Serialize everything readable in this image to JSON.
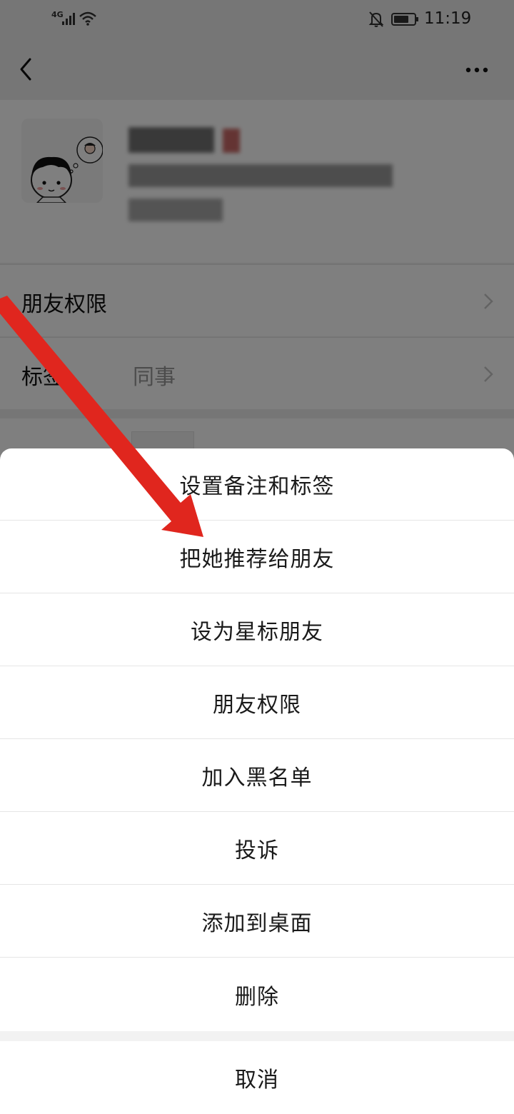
{
  "status_bar": {
    "network": "4G",
    "time": "11:19",
    "icons": [
      "signal-icon",
      "wifi-icon",
      "mute-bell-icon",
      "battery-icon"
    ]
  },
  "header": {
    "back_icon": "chevron-left-icon",
    "more_icon": "more-dots-icon"
  },
  "profile": {
    "avatar_icon": "cartoon-avatar-icon"
  },
  "rows": [
    {
      "label": "朋友权限",
      "value": ""
    },
    {
      "label": "标签",
      "value": "同事"
    }
  ],
  "action_sheet": {
    "items": [
      "设置备注和标签",
      "把她推荐给朋友",
      "设为星标朋友",
      "朋友权限",
      "加入黑名单",
      "投诉",
      "添加到桌面",
      "删除"
    ],
    "cancel_label": "取消"
  },
  "annotation": {
    "arrow_icon": "red-arrow-icon",
    "arrow_color": "#e0261e"
  },
  "colors": {
    "page_background": "#ededed",
    "overlay": "rgba(0,0,0,0.5)",
    "sheet_background": "#ffffff"
  }
}
